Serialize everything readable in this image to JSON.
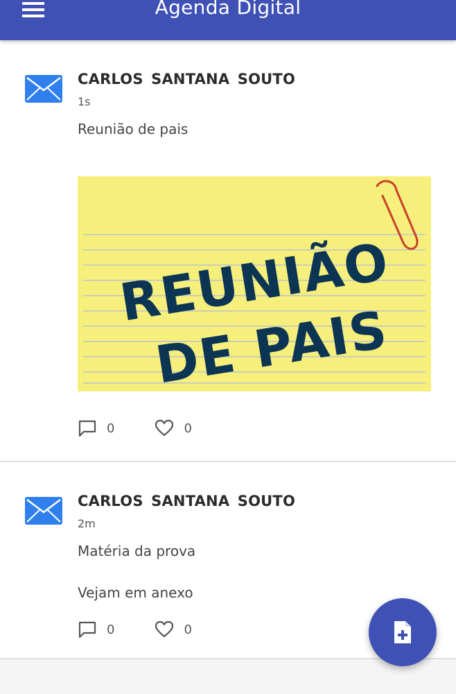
{
  "app_bar": {
    "title": "Agenda Digital",
    "menu_icon": "hamburger-menu-icon",
    "color": "#3f51b5"
  },
  "posts": [
    {
      "author": "CARLOS SANTANA SOUTO",
      "time": "1s",
      "message": "Reunião de pais",
      "icon": "envelope-icon",
      "image": {
        "line1": "REUNIÃO",
        "line2": "DE PAIS"
      },
      "comments": "0",
      "likes": "0"
    },
    {
      "author": "CARLOS SANTANA SOUTO",
      "time": "2m",
      "message": "Matéria da prova",
      "body": "Vejam em anexo",
      "icon": "envelope-icon",
      "comments": "0",
      "likes": "0"
    }
  ],
  "fab": {
    "icon": "add-file-icon"
  }
}
